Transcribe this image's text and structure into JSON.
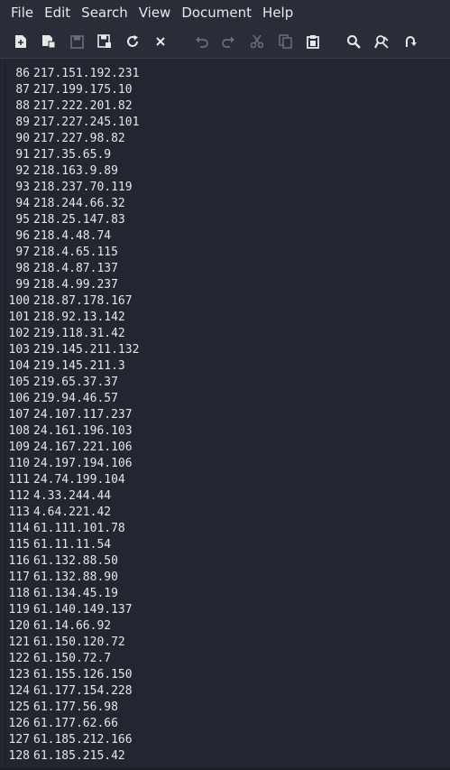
{
  "menu": [
    "File",
    "Edit",
    "Search",
    "View",
    "Document",
    "Help"
  ],
  "toolbar": {
    "icons": [
      "new-document-icon",
      "new-window-icon",
      "save-icon",
      "save-as-icon",
      "reload-icon",
      "close-icon",
      "undo-icon",
      "redo-icon",
      "cut-icon",
      "copy-icon",
      "paste-icon",
      "find-icon",
      "find-replace-icon",
      "goto-line-icon"
    ]
  },
  "colors": {
    "background": "#232630",
    "chrome": "#2a2d37",
    "text": "#e6e6e6",
    "disabled_icon": "#6b6e78"
  },
  "editor": {
    "lines": [
      {
        "n": "86",
        "t": "217.151.192.231"
      },
      {
        "n": "87",
        "t": "217.199.175.10"
      },
      {
        "n": "88",
        "t": "217.222.201.82"
      },
      {
        "n": "89",
        "t": "217.227.245.101"
      },
      {
        "n": "90",
        "t": "217.227.98.82"
      },
      {
        "n": "91",
        "t": "217.35.65.9"
      },
      {
        "n": "92",
        "t": "218.163.9.89"
      },
      {
        "n": "93",
        "t": "218.237.70.119"
      },
      {
        "n": "94",
        "t": "218.244.66.32"
      },
      {
        "n": "95",
        "t": "218.25.147.83"
      },
      {
        "n": "96",
        "t": "218.4.48.74"
      },
      {
        "n": "97",
        "t": "218.4.65.115"
      },
      {
        "n": "98",
        "t": "218.4.87.137"
      },
      {
        "n": "99",
        "t": "218.4.99.237"
      },
      {
        "n": "100",
        "t": "218.87.178.167"
      },
      {
        "n": "101",
        "t": "218.92.13.142"
      },
      {
        "n": "102",
        "t": "219.118.31.42"
      },
      {
        "n": "103",
        "t": "219.145.211.132"
      },
      {
        "n": "104",
        "t": "219.145.211.3"
      },
      {
        "n": "105",
        "t": "219.65.37.37"
      },
      {
        "n": "106",
        "t": "219.94.46.57"
      },
      {
        "n": "107",
        "t": "24.107.117.237"
      },
      {
        "n": "108",
        "t": "24.161.196.103"
      },
      {
        "n": "109",
        "t": "24.167.221.106"
      },
      {
        "n": "110",
        "t": "24.197.194.106"
      },
      {
        "n": "111",
        "t": "24.74.199.104"
      },
      {
        "n": "112",
        "t": "4.33.244.44"
      },
      {
        "n": "113",
        "t": "4.64.221.42"
      },
      {
        "n": "114",
        "t": "61.111.101.78"
      },
      {
        "n": "115",
        "t": "61.11.11.54"
      },
      {
        "n": "116",
        "t": "61.132.88.50"
      },
      {
        "n": "117",
        "t": "61.132.88.90"
      },
      {
        "n": "118",
        "t": "61.134.45.19"
      },
      {
        "n": "119",
        "t": "61.140.149.137"
      },
      {
        "n": "120",
        "t": "61.14.66.92"
      },
      {
        "n": "121",
        "t": "61.150.120.72"
      },
      {
        "n": "122",
        "t": "61.150.72.7"
      },
      {
        "n": "123",
        "t": "61.155.126.150"
      },
      {
        "n": "124",
        "t": "61.177.154.228"
      },
      {
        "n": "125",
        "t": "61.177.56.98"
      },
      {
        "n": "126",
        "t": "61.177.62.66"
      },
      {
        "n": "127",
        "t": "61.185.212.166"
      },
      {
        "n": "128",
        "t": "61.185.215.42"
      }
    ]
  }
}
